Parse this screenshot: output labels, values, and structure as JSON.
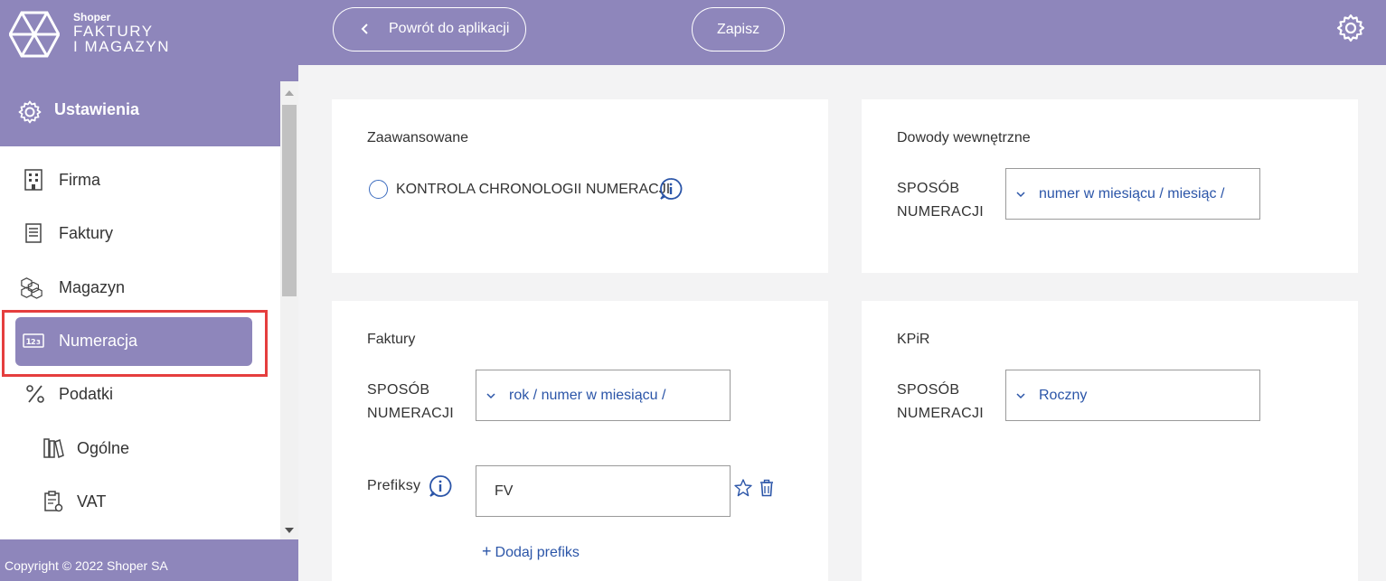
{
  "brand": {
    "small": "Shoper",
    "line1": "FAKTURY",
    "line2": "I MAGAZYN"
  },
  "sidebar": {
    "section_title": "Ustawienia",
    "items": [
      {
        "label": "Firma",
        "icon": "building-icon"
      },
      {
        "label": "Faktury",
        "icon": "invoice-icon"
      },
      {
        "label": "Magazyn",
        "icon": "boxes-icon"
      },
      {
        "label": "Numeracja",
        "icon": "numbering-icon",
        "active": true
      },
      {
        "label": "Podatki",
        "icon": "percent-icon"
      },
      {
        "label": "Ogólne",
        "icon": "books-icon"
      },
      {
        "label": "VAT",
        "icon": "clipboard-icon"
      }
    ],
    "footer": "Copyright © 2022 Shoper SA"
  },
  "topbar": {
    "back_label": "Powrót do aplikacji",
    "save_label": "Zapisz"
  },
  "cards": {
    "advanced": {
      "title": "Zaawansowane",
      "radio_label": "KONTROLA CHRONOLOGII NUMERACJI"
    },
    "internal": {
      "title": "Dowody wewnętrzne",
      "label_line1": "SPOSÓB",
      "label_line2": "NUMERACJI",
      "value": "numer w miesiącu / miesiąc /"
    },
    "invoices": {
      "title": "Faktury",
      "label_line1": "SPOSÓB",
      "label_line2": "NUMERACJI",
      "value": "rok / numer w miesiącu /",
      "prefix_label": "Prefiksy",
      "prefix_value": "FV",
      "add_prefix": "Dodaj prefiks"
    },
    "kpir": {
      "title": "KPiR",
      "label_line1": "SPOSÓB",
      "label_line2": "NUMERACJI",
      "value": "Roczny"
    }
  },
  "colors": {
    "accent": "#8e86bb",
    "link": "#2b55a8",
    "highlight": "#e53e3e"
  }
}
